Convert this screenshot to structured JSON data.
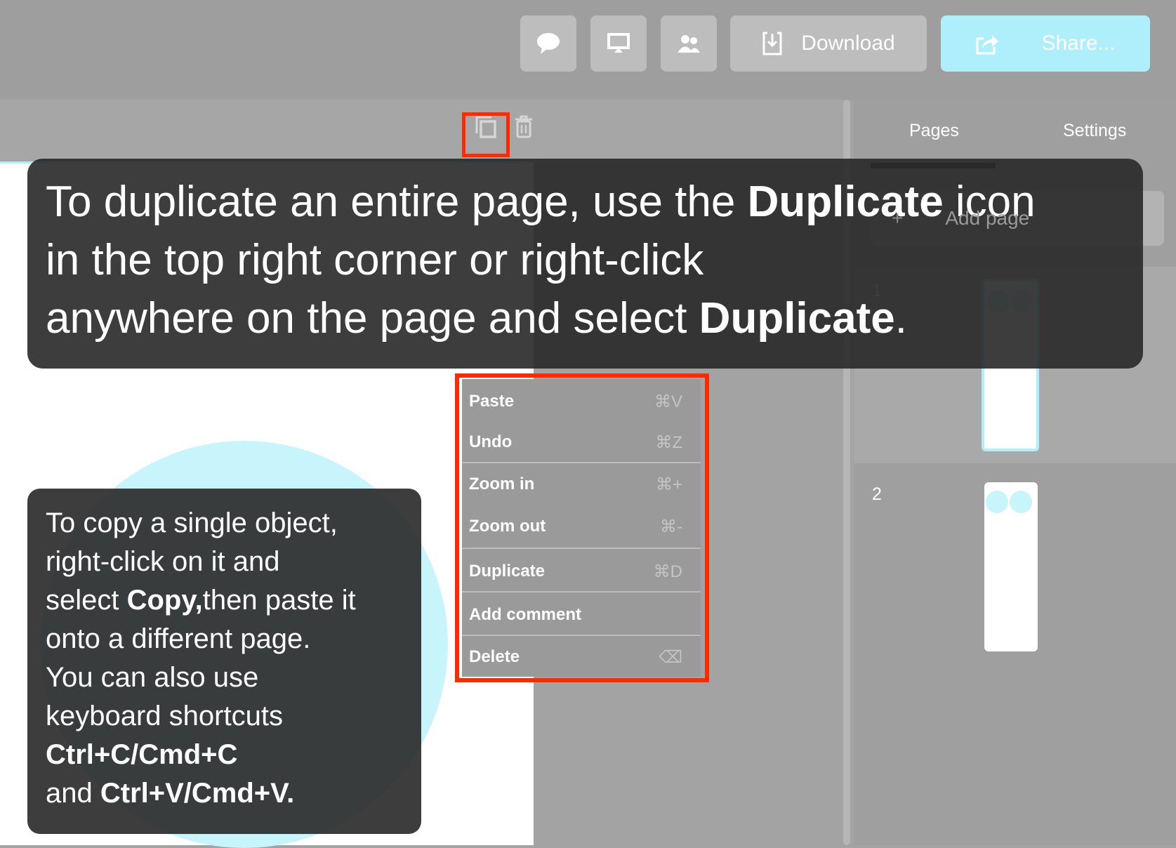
{
  "topbar": {
    "buttons": [
      {
        "icon": "comment-icon"
      },
      {
        "icon": "monitor-icon"
      },
      {
        "icon": "users-icon"
      }
    ],
    "download_label": "Download",
    "share_label": "Share...",
    "share_color": "#aeeffb"
  },
  "toolbar": {
    "duplicate_icon": "duplicate-icon",
    "delete_icon": "trash-icon",
    "highlight_color": "#ff2a00"
  },
  "right_panel": {
    "tabs": [
      {
        "label": "Pages",
        "active": true
      },
      {
        "label": "Settings",
        "active": false
      }
    ],
    "add_page_label": "Add page",
    "pages": [
      {
        "number": "1",
        "selected": true
      },
      {
        "number": "2",
        "selected": false
      }
    ]
  },
  "context_menu": {
    "items": [
      {
        "label": "Paste",
        "shortcut": "⌘V"
      },
      {
        "label": "Undo",
        "shortcut": "⌘Z"
      },
      {
        "label": "Zoom in",
        "shortcut": "⌘+"
      },
      {
        "label": "Zoom out",
        "shortcut": "⌘-"
      },
      {
        "label": "Duplicate",
        "shortcut": "⌘D"
      },
      {
        "label": "Add comment",
        "shortcut": ""
      },
      {
        "label": "Delete",
        "shortcut": "⌫"
      }
    ]
  },
  "tooltips": {
    "page_duplicate": [
      [
        {
          "t": "To duplicate an entire page, use the "
        },
        {
          "t": "Duplicate",
          "b": true
        },
        {
          "t": " icon"
        }
      ],
      [
        {
          "t": "in the top right corner or right-click"
        }
      ],
      [
        {
          "t": "anywhere on the page and select "
        },
        {
          "t": "Duplicate",
          "b": true
        },
        {
          "t": "."
        }
      ]
    ],
    "object_copy": [
      [
        {
          "t": "To copy a single object,"
        }
      ],
      [
        {
          "t": "right-click on it and"
        }
      ],
      [
        {
          "t": "select "
        },
        {
          "t": "Copy,",
          "b": true
        },
        {
          "t": "then paste it"
        }
      ],
      [
        {
          "t": "onto a different page."
        }
      ],
      [
        {
          "t": "You can also use"
        }
      ],
      [
        {
          "t": "keyboard shortcuts"
        }
      ],
      [
        {
          "t": "Ctrl+C/Cmd+C",
          "b": true
        }
      ],
      [
        {
          "t": "and "
        },
        {
          "t": "Ctrl+V/Cmd+V.",
          "b": true
        }
      ]
    ]
  }
}
